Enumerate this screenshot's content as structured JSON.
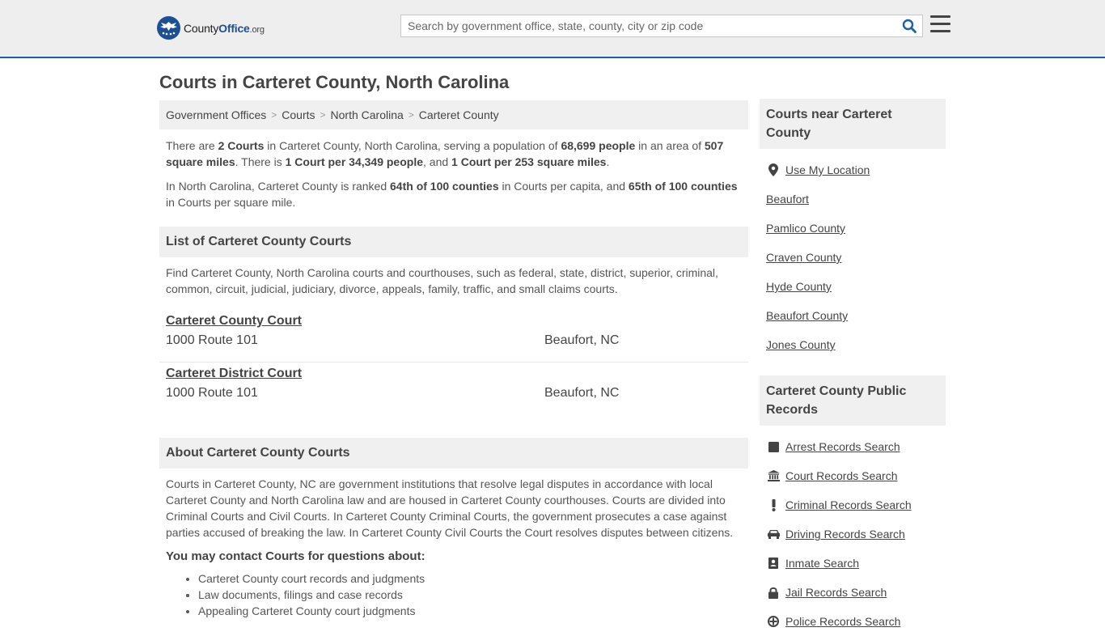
{
  "header": {
    "logo": {
      "word1": "County",
      "word2": "Office",
      "tld": ".org"
    },
    "search_placeholder": "Search by government office, state, county, city or zip code"
  },
  "page_title": "Courts in Carteret County, North Carolina",
  "breadcrumb": [
    "Government Offices",
    "Courts",
    "North Carolina",
    "Carteret County"
  ],
  "intro": {
    "p1": [
      "There are ",
      "2 Courts",
      " in Carteret County, North Carolina, serving a population of ",
      "68,699 people",
      " in an area of ",
      "507 square miles",
      ". There is ",
      "1 Court per 34,349 people",
      ", and ",
      "1 Court per 253 square miles",
      "."
    ],
    "p2": [
      "In North Carolina, Carteret County is ranked ",
      "64th of 100 counties",
      " in Courts per capita, and ",
      "65th of 100 counties",
      " in Courts per square mile."
    ]
  },
  "list_section": {
    "title": "List of Carteret County Courts",
    "description": "Find Carteret County, North Carolina courts and courthouses, such as federal, state, district, superior, criminal, common, circuit, judicial, judiciary, divorce, appeals, family, traffic, and small claims courts.",
    "courts": [
      {
        "name": "Carteret County Court",
        "address": "1000 Route 101",
        "city": "Beaufort, NC"
      },
      {
        "name": "Carteret District Court",
        "address": "1000 Route 101",
        "city": "Beaufort, NC"
      }
    ]
  },
  "about_section": {
    "title": "About Carteret County Courts",
    "text": "Courts in Carteret County, NC are government institutions that resolve legal disputes in accordance with local Carteret County and North Carolina law and are housed in Carteret County courthouses. Courts are divided into Criminal Courts and Civil Courts. In Carteret County Criminal Courts, the government prosecutes a case against parties accused of breaking the law. In Carteret County Civil Courts the Court resolves disputes between citizens.",
    "contact_heading": "You may contact Courts for questions about:",
    "contact_items": [
      "Carteret County court records and judgments",
      "Law documents, filings and case records",
      "Appealing Carteret County court judgments"
    ]
  },
  "sidebar": {
    "nearby_title": "Courts near Carteret County",
    "use_location": "Use My Location",
    "nearby": [
      "Beaufort",
      "Pamlico County",
      "Craven County",
      "Hyde County",
      "Beaufort County",
      "Jones County"
    ],
    "records_title": "Carteret County Public Records",
    "records": [
      {
        "label": "Arrest Records Search",
        "icon": "square-icon"
      },
      {
        "label": "Court Records Search",
        "icon": "courthouse-icon"
      },
      {
        "label": "Criminal Records Search",
        "icon": "exclamation-icon"
      },
      {
        "label": "Driving Records Search",
        "icon": "car-icon"
      },
      {
        "label": "Inmate Search",
        "icon": "id-card-icon"
      },
      {
        "label": "Jail Records Search",
        "icon": "lock-icon"
      },
      {
        "label": "Police Records Search",
        "icon": "badge-icon"
      }
    ]
  }
}
